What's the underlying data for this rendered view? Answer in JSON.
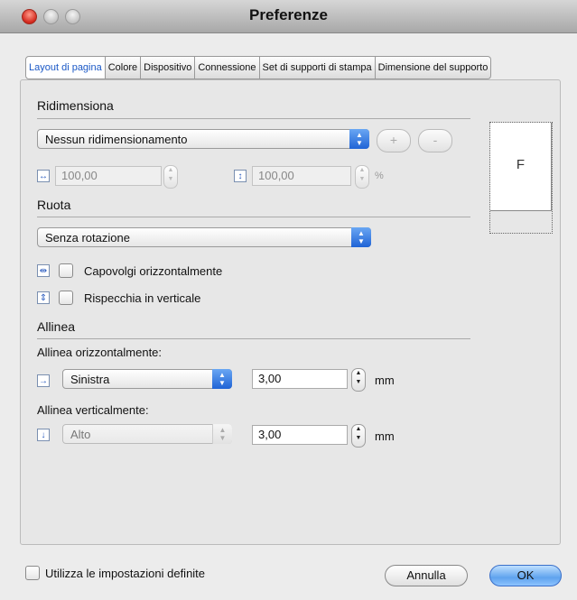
{
  "window": {
    "title": "Preferenze"
  },
  "tabs": [
    {
      "label": "Layout di pagina",
      "active": true
    },
    {
      "label": "Colore",
      "active": false
    },
    {
      "label": "Dispositivo",
      "active": false
    },
    {
      "label": "Connessione",
      "active": false
    },
    {
      "label": "Set di supporti di stampa",
      "active": false
    },
    {
      "label": "Dimensione del supporto",
      "active": false
    }
  ],
  "resize": {
    "heading": "Ridimensiona",
    "mode_selected": "Nessun ridimensionamento",
    "plus_label": "+",
    "minus_label": "-",
    "width_value": "100,00",
    "height_value": "100,00",
    "percent_unit": "%"
  },
  "rotate": {
    "heading": "Ruota",
    "selected": "Senza rotazione",
    "flip_horizontal_label": "Capovolgi orizzontalmente",
    "mirror_vertical_label": "Rispecchia in verticale"
  },
  "align": {
    "heading": "Allinea",
    "horizontal_label": "Allinea orizzontalmente:",
    "horizontal_selected": "Sinistra",
    "horizontal_offset": "3,00",
    "vertical_label": "Allinea verticalmente:",
    "vertical_selected": "Alto",
    "vertical_offset": "3,00",
    "unit": "mm"
  },
  "preview": {
    "letter": "F"
  },
  "footer": {
    "use_defined_settings_label": "Utilizza le impostazioni definite",
    "cancel_label": "Annulla",
    "ok_label": "OK"
  },
  "colors": {
    "accent": "#1f63d6",
    "close": "#d3271c"
  },
  "icons": {
    "width": "horizontal-resize-icon",
    "height": "vertical-resize-icon",
    "flip": "flip-horizontal-icon",
    "mirror": "mirror-vertical-icon",
    "align_h": "align-left-arrow-icon",
    "align_v": "align-down-arrow-icon"
  }
}
